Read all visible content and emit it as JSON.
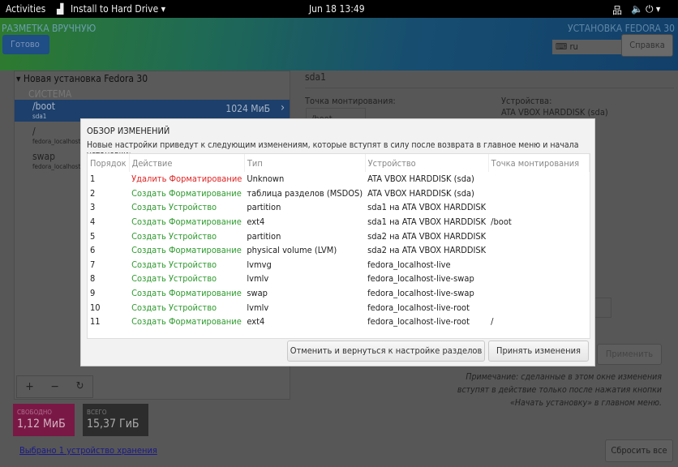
{
  "topbar": {
    "activities": "Activities",
    "app": "Install to Hard Drive ▾",
    "clock": "Jun 18  13:49"
  },
  "header": {
    "title": "РАЗМЕТКА ВРУЧНУЮ",
    "done": "Готово",
    "product": "УСТАНОВКА FEDORA 30",
    "keyboard": "ru",
    "help": "Справка"
  },
  "left": {
    "install_title": "Новая установка Fedora 30",
    "system": "СИСТЕМА",
    "items": [
      {
        "name": "/boot",
        "dev": "sda1",
        "size": "1024 МиБ"
      },
      {
        "name": "/",
        "dev": "fedora_localhost-live-root"
      },
      {
        "name": "swap",
        "dev": "fedora_localhost-live-swap"
      }
    ],
    "free_label": "СВОБОДНО",
    "free_value": "1,12 МиБ",
    "total_label": "ВСЕГО",
    "total_value": "15,37 ГиБ",
    "storage_link": "Выбрано 1 устройство хранения"
  },
  "right": {
    "partition": "sda1",
    "mount_label": "Точка монтирования:",
    "mount_value": "/boot",
    "devices_label": "Устройства:",
    "devices_value": "ATA VBOX HARDDISK (sda)",
    "apply": "Применить",
    "note": [
      "Примечание:  сделанные в этом окне изменения",
      "вступят в действие только после нажатия кнопки",
      "«Начать установку» в главном меню."
    ],
    "reset": "Сбросить все"
  },
  "dialog": {
    "title": "ОБЗОР ИЗМЕНЕНИЙ",
    "subtitle": "Новые настройки приведут к следующим изменениям, которые вступят в силу после возврата в главное меню и начала установки:",
    "columns": [
      "Порядок",
      "Действие",
      "Тип",
      "Устройство",
      "Точка монтирования"
    ],
    "rows": [
      [
        "1",
        "Удалить Форматирование",
        "Unknown",
        "ATA VBOX HARDDISK (sda)",
        ""
      ],
      [
        "2",
        "Создать Форматирование",
        "таблица разделов (MSDOS)",
        "ATA VBOX HARDDISK (sda)",
        ""
      ],
      [
        "3",
        "Создать Устройство",
        "partition",
        "sda1 на ATA VBOX HARDDISK",
        ""
      ],
      [
        "4",
        "Создать Форматирование",
        "ext4",
        "sda1 на ATA VBOX HARDDISK",
        "/boot"
      ],
      [
        "5",
        "Создать Устройство",
        "partition",
        "sda2 на ATA VBOX HARDDISK",
        ""
      ],
      [
        "6",
        "Создать Форматирование",
        "physical volume (LVM)",
        "sda2 на ATA VBOX HARDDISK",
        ""
      ],
      [
        "7",
        "Создать Устройство",
        "lvmvg",
        "fedora_localhost-live",
        ""
      ],
      [
        "8",
        "Создать Устройство",
        "lvmlv",
        "fedora_localhost-live-swap",
        ""
      ],
      [
        "9",
        "Создать Форматирование",
        "swap",
        "fedora_localhost-live-swap",
        ""
      ],
      [
        "10",
        "Создать Устройство",
        "lvmlv",
        "fedora_localhost-live-root",
        ""
      ],
      [
        "11",
        "Создать Форматирование",
        "ext4",
        "fedora_localhost-live-root",
        "/"
      ]
    ],
    "cancel": "Отменить и вернуться к настройке разделов",
    "accept": "Принять изменения"
  },
  "colors": {
    "delete": "#e02424",
    "create": "#2e9a2e",
    "free_bg": "#8a1a4a"
  }
}
